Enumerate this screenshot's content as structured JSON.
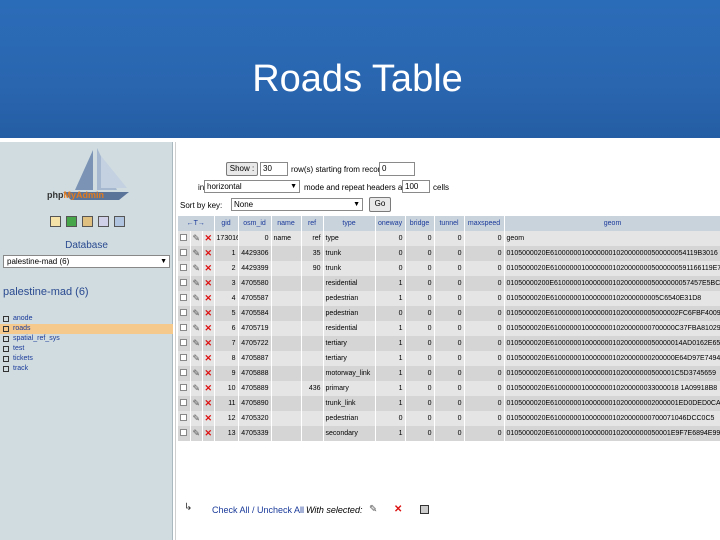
{
  "slide": {
    "title": "Roads Table"
  },
  "nav": {
    "logo_prefix": "php",
    "logo_accent": "MyAdmin",
    "database_label": "Database",
    "database_selected": "palestine-mad (6)",
    "db_title": "palestine-mad (6)",
    "tables": [
      "anode",
      "roads",
      "spatial_ref_sys",
      "test",
      "tickets",
      "track"
    ],
    "active_table": "roads"
  },
  "controls": {
    "show_label": "Show :",
    "show_count": "30",
    "rows_text": "row(s) starting from record #",
    "start_record": "0",
    "in_label": "in",
    "mode": "horizontal",
    "mode_text": "mode and repeat headers after",
    "repeat": "100",
    "cells_text": "cells",
    "sort_label": "Sort by key:",
    "sort_value": "None",
    "go_label": "Go"
  },
  "table": {
    "columns": [
      "gid",
      "osm_id",
      "name",
      "ref",
      "type",
      "oneway",
      "bridge",
      "tunnel",
      "maxspeed",
      "geom"
    ],
    "rows": [
      [
        "173016",
        "0",
        "name",
        "ref",
        "type",
        "0",
        "0",
        "0",
        "0",
        "geom"
      ],
      [
        "1",
        "4429306",
        "",
        "35",
        "trunk",
        "0",
        "0",
        "0",
        "0",
        "0105000020E61000000100000001020000000500000054119B3016"
      ],
      [
        "2",
        "4429399",
        "",
        "90",
        "trunk",
        "0",
        "0",
        "0",
        "0",
        "0105000020E610000001000000010200000005000000591166119E7A"
      ],
      [
        "3",
        "4705580",
        "",
        "",
        "residential",
        "1",
        "0",
        "0",
        "0",
        "01050000200E61000001000000010200000005000000057457E5BCA3"
      ],
      [
        "4",
        "4705587",
        "",
        "",
        "pedestrian",
        "1",
        "0",
        "0",
        "0",
        "0105000020E6100000010000000102000000005C6540E31D8"
      ],
      [
        "5",
        "4705584",
        "",
        "",
        "pedestrian",
        "0",
        "0",
        "0",
        "0",
        "0105000020E610000001000000010200000005000002FC6FBF4009"
      ],
      [
        "6",
        "4705719",
        "",
        "",
        "residential",
        "1",
        "0",
        "0",
        "0",
        "0105000020E61000000100000001020000000700000C37FBA81029"
      ],
      [
        "7",
        "4705722",
        "",
        "",
        "tertiary",
        "1",
        "0",
        "0",
        "0",
        "0105000020E6100000010000000102000000050000014AD0162E65"
      ],
      [
        "8",
        "4705887",
        "",
        "",
        "tertiary",
        "1",
        "0",
        "0",
        "0",
        "0105000020E61000000100000001020000000200000E64D97E7494"
      ],
      [
        "9",
        "4705888",
        "",
        "",
        "motorway_link",
        "1",
        "0",
        "0",
        "0",
        "0105000020E61000000100000001020000000500001C5D3745659"
      ],
      [
        "10",
        "4705889",
        "",
        "436",
        "primary",
        "1",
        "0",
        "0",
        "0",
        "0105000020E610000001000000010200000033000018 1A09918B8"
      ],
      [
        "11",
        "4705890",
        "",
        "",
        "trunk_link",
        "1",
        "0",
        "0",
        "0",
        "0105000020E610000001000000010200000002000001ED0DED0CA5"
      ],
      [
        "12",
        "4705320",
        "",
        "",
        "pedestrian",
        "0",
        "0",
        "0",
        "0",
        "0105000020E61000000100000001020000000700071046DCC0C5"
      ],
      [
        "13",
        "4705339",
        "",
        "",
        "secondary",
        "1",
        "0",
        "0",
        "0",
        "0105000020E6100000010000000102000000050001E9F7E6894E99"
      ]
    ]
  },
  "footer": {
    "check_all": "Check All / Uncheck All",
    "with_selected": "With selected:"
  }
}
